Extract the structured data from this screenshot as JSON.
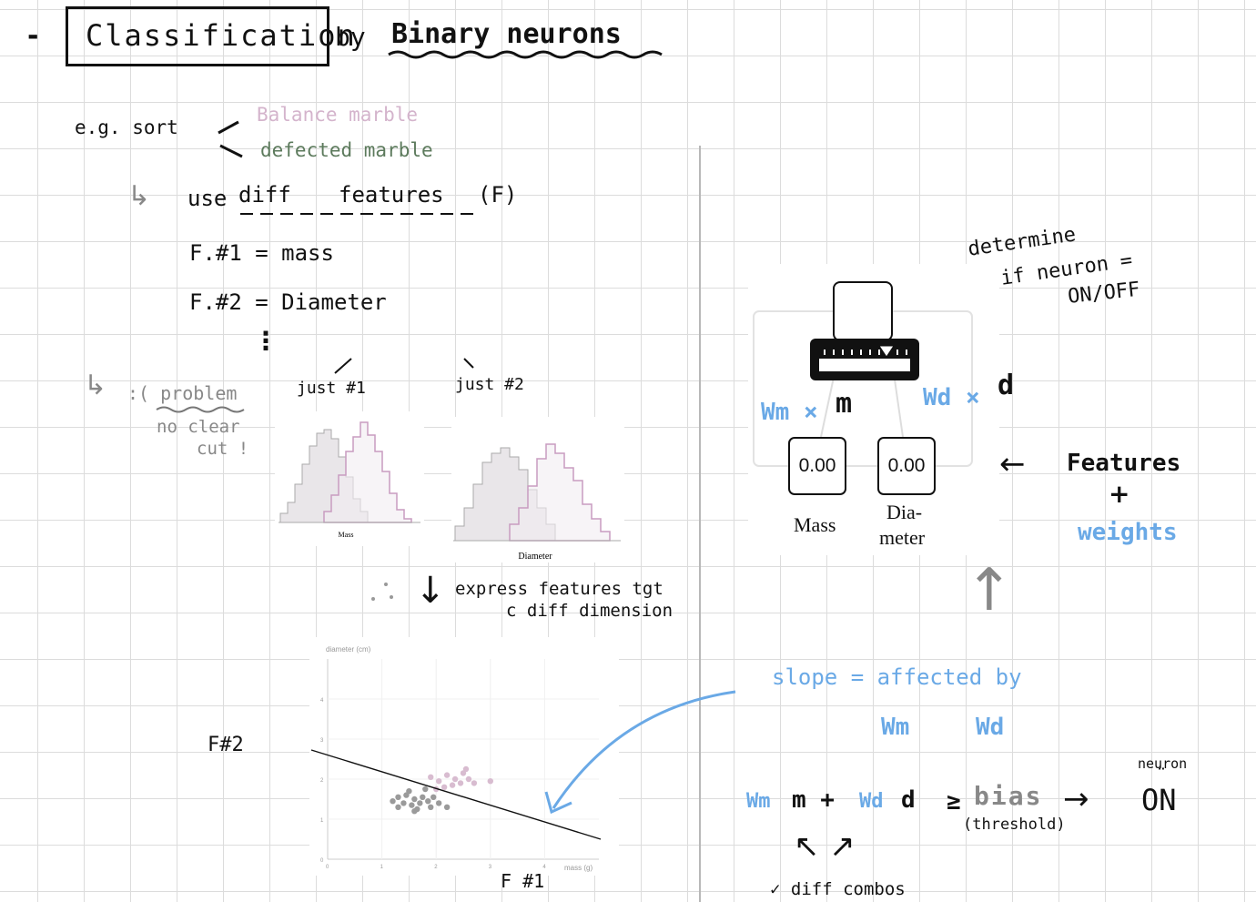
{
  "title": {
    "dash": "-",
    "boxed": "Classification",
    "rest_by": "by",
    "rest_main": "Binary neurons"
  },
  "sort": {
    "label": "e.g. sort",
    "option1": "Balance marble",
    "option2": "defected marble"
  },
  "features": {
    "arrow": "↳",
    "use_prefix": "use",
    "diff": "diff",
    "word": "features",
    "suffix": "(F)",
    "f1": "F.#1  = mass",
    "f2": "F.#2  = Diameter",
    "ellipsis": "⋮"
  },
  "problem": {
    "arrow": "↳",
    "label": ":( problem",
    "note1": "no clear",
    "note2": "cut !"
  },
  "hist_labels": {
    "just1": "just #1",
    "just2": "just #2"
  },
  "histograms": [
    {
      "caption": "Mass"
    },
    {
      "caption": "Diameter"
    }
  ],
  "express": {
    "arrow": "↓",
    "line1": "express features tgt",
    "line2": "c diff dimension"
  },
  "scatter": {
    "y_axis_label": "diameter (cm)",
    "x_axis_label": "mass (g)",
    "y_ticks": [
      "0",
      "1",
      "2",
      "3",
      "4"
    ],
    "x_ticks": [
      "0",
      "1",
      "2",
      "3",
      "4"
    ],
    "f2_label": "F#2",
    "f1_label": "F #1"
  },
  "neuron": {
    "determine1": "determine",
    "determine2": "if neuron =",
    "determine3": "ON/OFF",
    "wm_label": "Wm ×",
    "m_label": "m",
    "wd_label": "Wd ×",
    "d_label": "d",
    "mass_value": "0.00",
    "diameter_value": "0.00",
    "mass_caption": "Mass",
    "diameter_caption_1": "Dia-",
    "diameter_caption_2": "meter",
    "features_arrow": "←",
    "features_label": "Features",
    "plus": "+",
    "weights_label": "weights"
  },
  "slope": {
    "up_arrow": "↑",
    "text": "slope = affected by",
    "wm": "Wm",
    "wd": "Wd"
  },
  "formula": {
    "wm": "Wm",
    "m": "m +",
    "wd": "Wd",
    "d": "d",
    "geq": "≥",
    "bias": "bias",
    "threshold": "(threshold)",
    "arrow": "→",
    "neuron_small": "neuron",
    "dots": "¨",
    "on": "ON",
    "arrows_up": "↖  ↗",
    "combos": "✓ diff combos"
  },
  "colors": {
    "pink": "#d4b4cc",
    "blue": "#6aa9e6",
    "green": "#5c7a5c",
    "grey": "#888888",
    "hist_fill": "#e8e4e8",
    "hist_line": "#c89cc0",
    "dot_grey": "#9a9a9a",
    "dot_pink": "#d8bcd0"
  },
  "icons": [
    "neuron-ruler-icon",
    "left-arrow-icon",
    "curved-arrow-icon"
  ]
}
